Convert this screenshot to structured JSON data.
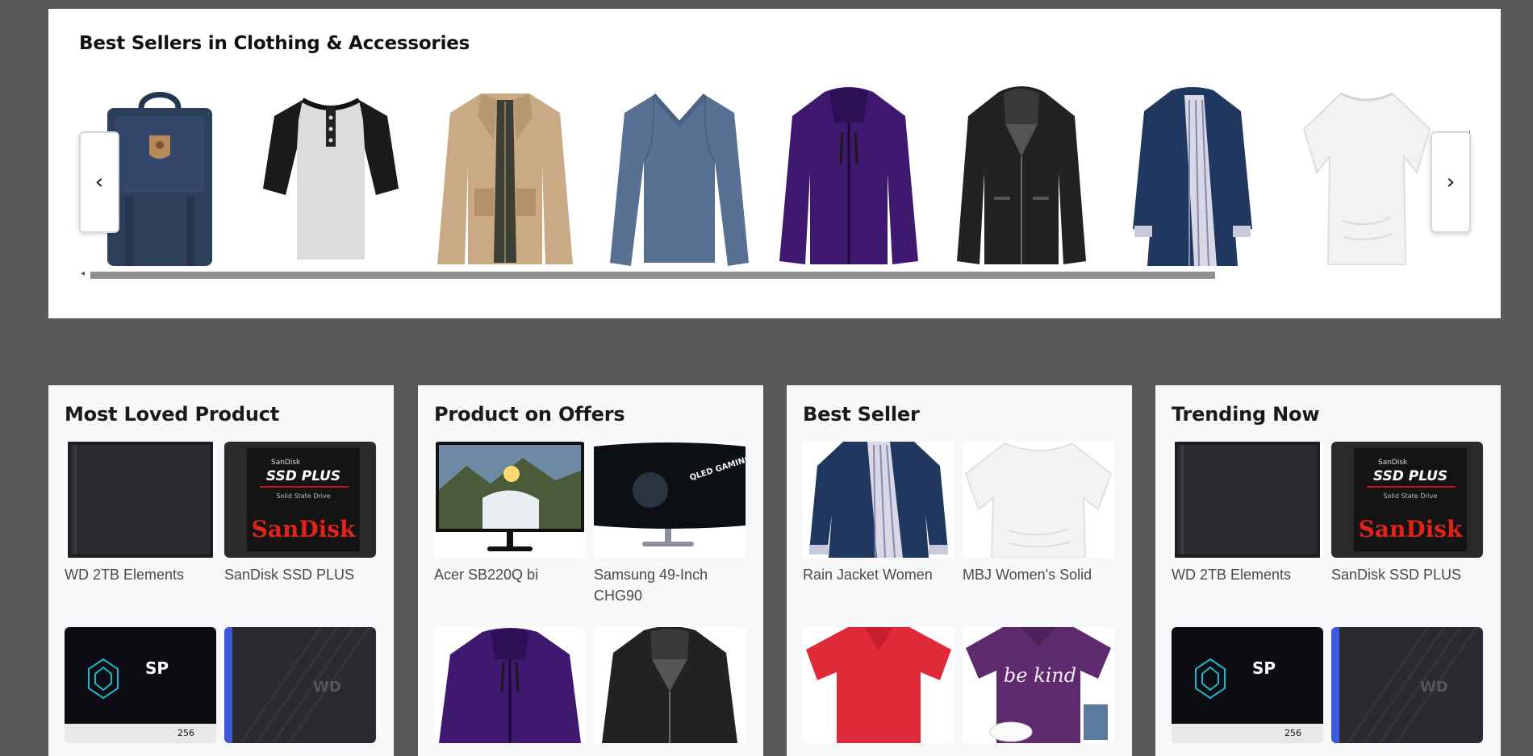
{
  "carousel": {
    "title": "Best Sellers in Clothing & Accessories",
    "prev_label": "‹",
    "next_label": "›",
    "scroll_left": "◂",
    "scroll_right": "▸",
    "items": [
      {
        "icon": "backpack-icon",
        "color": "#2e3f5c"
      },
      {
        "icon": "henley-shirt-icon",
        "color": "#dcdcdc"
      },
      {
        "icon": "khaki-jacket-icon",
        "color": "#c9aa84"
      },
      {
        "icon": "blue-sweater-icon",
        "color": "#587094"
      },
      {
        "icon": "purple-jacket-icon",
        "color": "#3f1870"
      },
      {
        "icon": "leather-jacket-icon",
        "color": "#222222"
      },
      {
        "icon": "navy-raincoat-icon",
        "color": "#203760"
      },
      {
        "icon": "white-top-icon",
        "color": "#f2f2f2"
      }
    ]
  },
  "cards": [
    {
      "title": "Most Loved Product",
      "tiles": [
        {
          "label": "WD 2TB Elements",
          "icon": "hard-drive-icon"
        },
        {
          "label": "SanDisk SSD PLUS",
          "icon": "sandisk-ssd-icon",
          "brand_top": "SanDisk",
          "brand_line": "SSD PLUS",
          "brand_sub": "Solid State Drive",
          "brand_logo": "SanDisk"
        },
        {
          "label": "",
          "icon": "sp-ssd-icon",
          "brand_top": "SP",
          "capacity": "256"
        },
        {
          "label": "",
          "icon": "wd-passport-icon",
          "brand_top": "WD"
        }
      ]
    },
    {
      "title": "Product on Offers",
      "tiles": [
        {
          "label": "Acer SB220Q bi",
          "icon": "monitor-landscape-icon"
        },
        {
          "label": "Samsung 49-Inch CHG90",
          "icon": "curved-monitor-icon",
          "screen_text": "QLED GAMING MONITOR"
        },
        {
          "label": "",
          "icon": "purple-jacket-icon"
        },
        {
          "label": "",
          "icon": "leather-jacket-icon"
        }
      ]
    },
    {
      "title": "Best Seller",
      "tiles": [
        {
          "label": "Rain Jacket Women",
          "icon": "navy-raincoat-icon"
        },
        {
          "label": "MBJ Women's Solid",
          "icon": "white-top-icon"
        },
        {
          "label": "",
          "icon": "red-polo-icon"
        },
        {
          "label": "",
          "icon": "be-kind-shirt-icon",
          "shirt_text": "be kind"
        }
      ]
    },
    {
      "title": "Trending Now",
      "tiles": [
        {
          "label": "WD 2TB Elements",
          "icon": "hard-drive-icon"
        },
        {
          "label": "SanDisk SSD PLUS",
          "icon": "sandisk-ssd-icon",
          "brand_top": "SanDisk",
          "brand_line": "SSD PLUS",
          "brand_sub": "Solid State Drive",
          "brand_logo": "SanDisk"
        },
        {
          "label": "",
          "icon": "sp-ssd-icon",
          "brand_top": "SP",
          "capacity": "256"
        },
        {
          "label": "",
          "icon": "wd-passport-icon",
          "brand_top": "WD"
        }
      ]
    }
  ]
}
